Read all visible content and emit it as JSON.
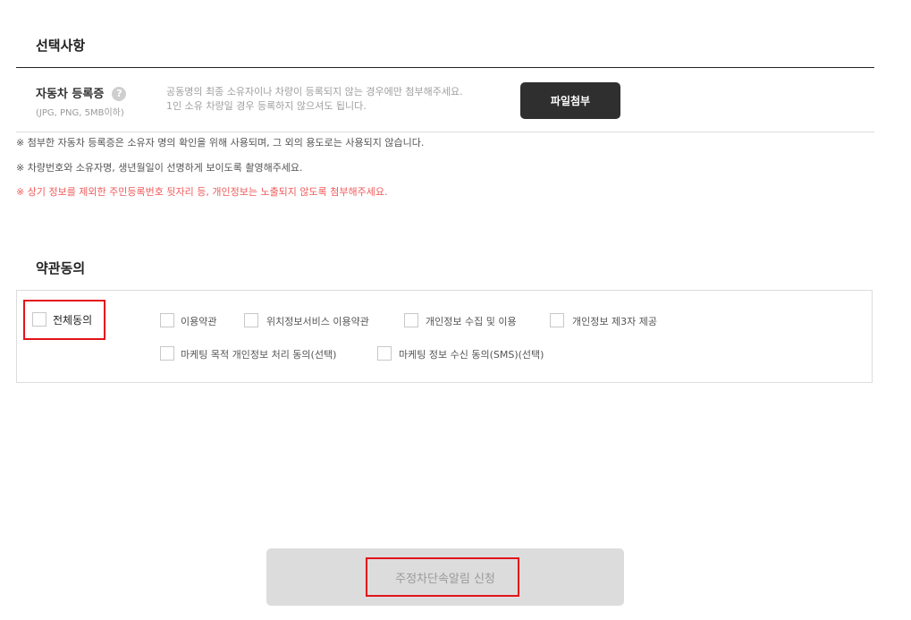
{
  "optional": {
    "title": "선택사항",
    "registration": {
      "label": "자동차 등록증",
      "help": "?",
      "subnote": "(JPG, PNG, 5MB이하)",
      "desc_line1": "공동명의 최종 소유자이나 차량이 등록되지 않는 경우에만 첨부해주세요.",
      "desc_line2": "1인 소유 차량일 경우 등록하지 않으셔도 됩니다.",
      "button": "파일첨부"
    },
    "notes": [
      "※ 첨부한 자동차 등록증은 소유자 명의 확인을 위해 사용되며, 그 외의 용도로는 사용되지 않습니다.",
      "※ 차량번호와 소유자명, 생년월일이 선명하게 보이도록 촬영해주세요.",
      "※ 상기 정보를 제외한 주민등록번호 뒷자리 등, 개인정보는 노출되지 않도록 첨부해주세요."
    ]
  },
  "terms": {
    "title": "약관동의",
    "all": "전체동의",
    "items": [
      "이용약관",
      "위치정보서비스 이용약관",
      "개인정보 수집 및 이용",
      "개인정보 제3자 제공",
      "마케팅 목적 개인정보 처리 동의(선택)",
      "마케팅 정보 수신 동의(SMS)(선택)"
    ]
  },
  "submit": {
    "label": "주정차단속알림 신청"
  },
  "colors": {
    "highlight": "#e3141b",
    "note_red": "#ef5b5b",
    "button_dark": "#2f2f2f"
  }
}
